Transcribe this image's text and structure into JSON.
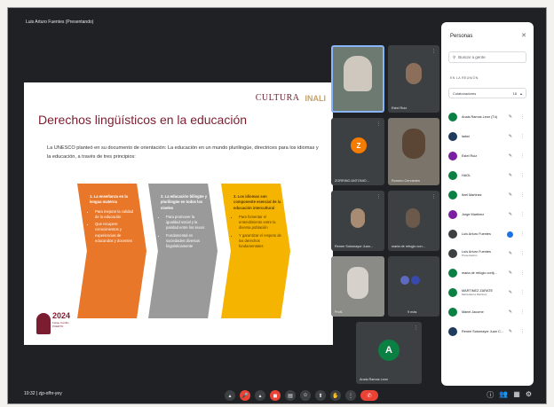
{
  "meeting": {
    "title": "Luis Arturo Fuentes (Presentando)",
    "time": "10:32",
    "code": "zjp-ofhr-yey"
  },
  "slide": {
    "logo_cultura": "CULTURA",
    "logo_inali": "INALI",
    "title": "Derechos lingüísticos en la educación",
    "intro": "La UNESCO planteó en su documento de orientación: La educación en un mundo plurilingüe, directrices para los idiomas y la educación, a través de tres principios:",
    "columns": [
      {
        "head": "1. La enseñanza en la lengua materna",
        "items": [
          "Para mejorar la calidad de la educación",
          "Que recupere conocimientos y experiencias de educandos y docentes"
        ]
      },
      {
        "head": "2. La educación bilingüe y plurilingüe en todos los niveles",
        "items": [
          "Para promover la igualdad social y la paridad entre los sexos",
          "Fundamental en sociedades diversas lingüísticamente"
        ]
      },
      {
        "head": "3. Los idiomas son componente esencial de la educación intercultural",
        "items": [
          "Para fomentar el entendimiento entre la diversa población",
          "Y garantizar el respeto de los derechos fundamentales"
        ]
      }
    ],
    "logo2024_year": "2024",
    "logo2024_sub": "Felipe Carrillo PUERTO"
  },
  "tiles": [
    {
      "name": "Estel Ruiz"
    },
    {
      "name": "ZORRINO ANTONIO..."
    },
    {
      "name": "Romero Cervantes"
    },
    {
      "name": "Renee Sotomayor Juan..."
    },
    {
      "name": "maria de refugio con..."
    },
    {
      "name": "ProfL"
    },
    {
      "name": "9 más"
    },
    {
      "name": "Anais Ramos Leon"
    }
  ],
  "tile_avatars": {
    "z": "Z",
    "a": "A"
  },
  "panel": {
    "title": "Personas",
    "close_icon": "✕",
    "search_placeholder": "Buscar a gente",
    "section": "EN LA REUNIÓN",
    "collab_label": "Colaboradores",
    "collab_count": "18",
    "people": [
      {
        "name": "Anais Ramos Leon (Tú)",
        "sub": "",
        "color": "#0b8043"
      },
      {
        "name": "ladwi",
        "sub": "",
        "color": "#1e3a5f"
      },
      {
        "name": "Estel Ruiz",
        "sub": "",
        "color": "#7b1fa2"
      },
      {
        "name": "HAOL",
        "sub": "",
        "color": "#0b8043"
      },
      {
        "name": "Itzel Martinez",
        "sub": "",
        "color": "#0b8043"
      },
      {
        "name": "Jorge Martinez",
        "sub": "",
        "color": "#7b1fa2"
      },
      {
        "name": "Luis Arturo Fuentes",
        "sub": "",
        "color": "#3c4043"
      },
      {
        "name": "Luis Arturo Fuentes",
        "sub": "Presentación",
        "color": "#3c4043"
      },
      {
        "name": "maria de refugio cortij...",
        "sub": "",
        "color": "#0b8043"
      },
      {
        "name": "MARTINEZ ZARATE",
        "sub": "Maria Elena Martínez",
        "color": "#0b8043"
      },
      {
        "name": "Mariel Jacome",
        "sub": "",
        "color": "#0b8043"
      },
      {
        "name": "Renee Sotomayor Juan C...",
        "sub": "",
        "color": "#1e3a5f"
      }
    ]
  },
  "controls": {
    "mic_icon": "🎤",
    "cam_icon": "◼",
    "cc_icon": "▤",
    "emoji_icon": "☺",
    "present_icon": "⬆",
    "hand_icon": "✋",
    "more_icon": "⋮",
    "end_icon": "✆",
    "info_icon": "ⓘ",
    "people_icon": "👥",
    "chat_icon": "▦",
    "activities_icon": "⚙"
  },
  "colors": {
    "slide_title": "#7b1d30",
    "col1": "#e8772a",
    "col2": "#9a9a9a",
    "col3": "#f5b400",
    "end_call": "#ea4335"
  }
}
